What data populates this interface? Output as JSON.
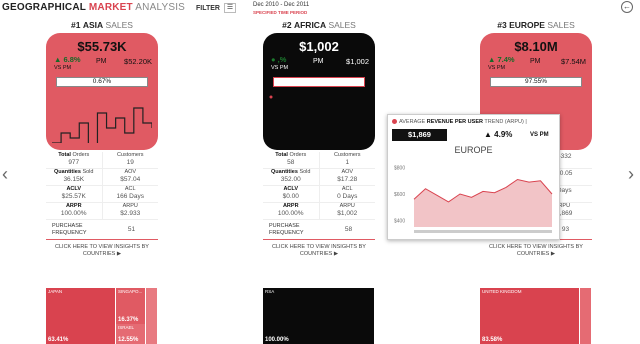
{
  "header": {
    "title_part1": "GEOGRAPHICAL ",
    "title_part2": "MARKET",
    "title_part3": " ANALYSIS",
    "filter_label": "FILTER",
    "filter_icon": "sliders-icon",
    "period": "Dec 2010 - Dec 2011",
    "period_label": "SPECIFIED TIME PERIOD"
  },
  "nav": {
    "left": "‹",
    "right": "›",
    "back": "←"
  },
  "cards": [
    {
      "rank": "#1",
      "region": "ASIA",
      "suffix": " SALES",
      "theme": "red",
      "value": "$55.73K",
      "change": "▲ 6.8%",
      "pm_label": "PM",
      "pm_value": "$52.20K",
      "vs": "VS PM",
      "bar_label": "0.67%",
      "bar_fill": 0.0067,
      "spark": [
        50,
        40,
        45,
        30,
        55,
        20,
        35,
        25,
        40,
        15,
        30,
        35
      ],
      "metrics": [
        {
          "l1": "Total",
          "l1b": true,
          "l2": " Orders",
          "v": "977",
          "r1": "Customers",
          "rv": "19"
        },
        {
          "l1": "Quantities",
          "l1b": true,
          "l2": " Sold",
          "v": "36.15K",
          "r1": "AOV",
          "rv": "$57.04"
        },
        {
          "l1": "ACLV",
          "l1b": false,
          "l2": "",
          "v": "$25.57K",
          "r1": "ACL",
          "rv": "166  Days"
        },
        {
          "l1": "ARPR",
          "l1b": false,
          "l2": "",
          "v": "100.00%",
          "r1": "ARPU",
          "rv": "$2.933"
        }
      ],
      "freq_label": "PURCHASE FREQUENCY",
      "freq_value": "51",
      "cta": "CLICK HERE TO VIEW INSIGHTS BY COUNTRIES ▶",
      "treemap": [
        {
          "name": "JAPAN",
          "pct": "63.41%",
          "color": "#d9434f"
        },
        {
          "name": "SINGAPO...",
          "pct": "16.37%",
          "color": "#e05a63"
        },
        {
          "name": "ISRAEL",
          "pct": "12.55%",
          "color": "#e56b73"
        },
        {
          "name": "",
          "pct": "",
          "color": "#e87a81"
        }
      ]
    },
    {
      "rank": "#2",
      "region": "AFRICA",
      "suffix": " SALES",
      "theme": "black",
      "value": "$1,002",
      "change": "● ,%",
      "pm_label": "PM",
      "pm_value": "$1,002",
      "vs": "VS PM",
      "bar_label": "0.01%",
      "bar_fill": 0.0001,
      "spark": [],
      "metrics": [
        {
          "l1": "Total",
          "l1b": true,
          "l2": " Orders",
          "v": "58",
          "r1": "Customers",
          "rv": "1"
        },
        {
          "l1": "Quantities",
          "l1b": true,
          "l2": " Sold",
          "v": "352.00",
          "r1": "AOV",
          "rv": "$17.28"
        },
        {
          "l1": "ACLV",
          "l1b": false,
          "l2": "",
          "v": "$0.00",
          "r1": "ACL",
          "rv": "0    Days"
        },
        {
          "l1": "ARPR",
          "l1b": false,
          "l2": "",
          "v": "100.00%",
          "r1": "ARPU",
          "rv": "$1,002"
        }
      ],
      "freq_label": "PURCHASE FREQUENCY",
      "freq_value": "58",
      "cta": "CLICK HERE TO VIEW INSIGHTS BY COUNTRIES ▶",
      "treemap": [
        {
          "name": "RSA",
          "pct": "100.00%",
          "color": "#0a0a0a"
        }
      ]
    },
    {
      "rank": "#3",
      "region": "EUROPE",
      "suffix": " SALES",
      "theme": "red",
      "value": "$8.10M",
      "change": "▲ 7.4%",
      "pm_label": "PM",
      "pm_value": "$7.54M",
      "vs": "VS PM",
      "bar_label": "97.55%",
      "bar_fill": 0.9755,
      "spark": [],
      "metrics": [
        {
          "l1": "",
          "l1b": false,
          "l2": "",
          "v": "",
          "r1": "",
          "rv": "4332"
        },
        {
          "l1": "",
          "l1b": false,
          "l2": "",
          "v": "",
          "r1": "",
          "rv": "20.05"
        },
        {
          "l1": "",
          "l1b": false,
          "l2": "",
          "v": "",
          "r1": "",
          "rv": "Days"
        },
        {
          "l1": "",
          "l1b": false,
          "l2": "",
          "v": "",
          "r1": "RPU",
          "rv": "1,869"
        }
      ],
      "freq_label": "PURCHASE FREQUENCY",
      "freq_value": "93",
      "cta": "CLICK HERE TO VIEW INSIGHTS BY COUNTRIES ▶",
      "treemap": [
        {
          "name": "UNITED KINGDOM",
          "pct": "83.58%",
          "color": "#d9434f"
        },
        {
          "name": "",
          "pct": "",
          "color": "#e56b73"
        }
      ]
    }
  ],
  "tooltip": {
    "heading_pre": "AVERAGE ",
    "heading_bold": "REVENUE PER USER",
    "heading_post": " TREND (ARPU) |",
    "value": "$1,869",
    "change": "▲  4.9%",
    "pm": "VS PM",
    "region": "EUROPE",
    "chart_data": {
      "type": "area",
      "yticks": [
        "$800",
        "$600",
        "$400"
      ],
      "ylim": [
        350,
        850
      ],
      "values": [
        560,
        640,
        590,
        540,
        600,
        575,
        620,
        610,
        650,
        710,
        690,
        700,
        600
      ]
    }
  }
}
